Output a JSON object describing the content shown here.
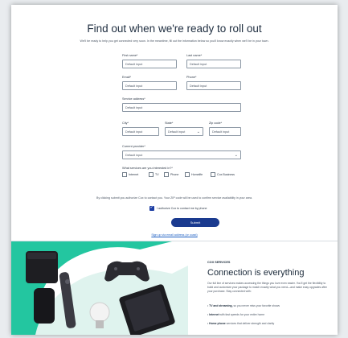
{
  "header": {
    "title": "Find out when we're ready to roll out",
    "intro": "We'll be ready to help you get connected very soon. In the meantime, fill out the information below so you'll know exactly when we'll be in your town."
  },
  "form": {
    "first_name": {
      "label": "First name*",
      "value": "Default input"
    },
    "last_name": {
      "label": "Last name*",
      "value": "Default input"
    },
    "email": {
      "label": "Email*",
      "value": "Default input"
    },
    "phone": {
      "label": "Phone*",
      "value": "Default input"
    },
    "service_address": {
      "label": "Service address*",
      "value": "Default input"
    },
    "city": {
      "label": "City*",
      "value": "Default input"
    },
    "state": {
      "label": "State*",
      "value": "Default input"
    },
    "zip": {
      "label": "Zip code*",
      "value": "Default input"
    },
    "provider": {
      "label": "Current provider*",
      "value": "Default input"
    },
    "services_label": "What services are you interested in?*",
    "services": [
      "Internet",
      "TV",
      "Phone",
      "Homelife",
      "Cox Business"
    ],
    "consent_text": "By clicking submit you authorize Cox to contact you. Your ZIP code will be used to confirm service availability in your area.",
    "contact_checkbox_label": "I authorize Cox to contact me by phone",
    "submit_label": "Submit",
    "alt_link": "Sign up via email address (or coast)"
  },
  "promo": {
    "eyebrow": "COX SERVICES",
    "headline": "Connection is everything",
    "description": "Our full line of services makes accessing the things you love even easier. You'll get the flexibility to build and customize your package to match exactly what you need—and make easy upgrades after your purchase. Stay connected with:",
    "bullets": [
      {
        "strong": "TV and streaming,",
        "text": " so you never miss your favorite shows"
      },
      {
        "strong": "Internet",
        "text": " with fast speeds for your entire home"
      },
      {
        "strong": "Home phone",
        "text": " services that deliver strength and clarity"
      }
    ]
  },
  "colors": {
    "accent": "#1a3a8f",
    "page_bg": "#e9ecef"
  }
}
